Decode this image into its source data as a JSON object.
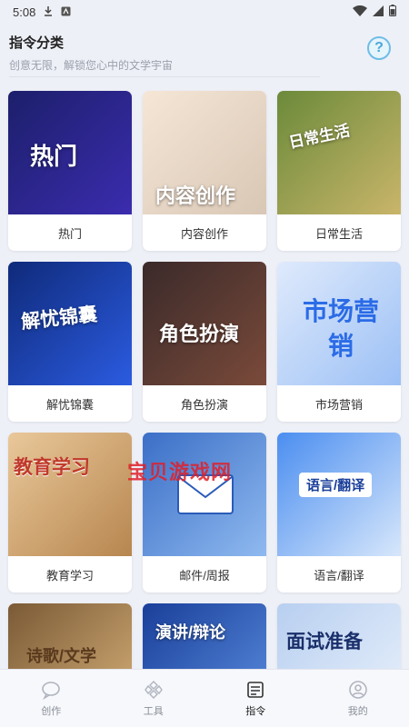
{
  "status": {
    "time": "5:08"
  },
  "header": {
    "title": "指令分类",
    "subtitle": "创意无限，解锁您心中的文学宇宙"
  },
  "cards": [
    {
      "label": "热门",
      "image_text": "热门",
      "colors": [
        "#1c1f6b",
        "#3b2cae"
      ]
    },
    {
      "label": "内容创作",
      "image_text": "内容创作",
      "colors": [
        "#f5e6d6",
        "#d9c7b5"
      ]
    },
    {
      "label": "日常生活",
      "image_text": "日常生活",
      "colors": [
        "#6b8a3a",
        "#c9b56a"
      ]
    },
    {
      "label": "解忧锦囊",
      "image_text": "解忧锦囊",
      "colors": [
        "#0f2a7a",
        "#2b5be0"
      ]
    },
    {
      "label": "角色扮演",
      "image_text": "角色扮演",
      "colors": [
        "#3a2a2a",
        "#7a4a3a"
      ]
    },
    {
      "label": "市场营销",
      "image_text": "市场营销",
      "colors": [
        "#dfeafc",
        "#9cc0f5"
      ]
    },
    {
      "label": "教育学习",
      "image_text": "教育学习",
      "colors": [
        "#e9c89a",
        "#b7864f"
      ]
    },
    {
      "label": "邮件/周报",
      "image_text": "",
      "colors": [
        "#3b6fc7",
        "#8fb9ef"
      ]
    },
    {
      "label": "语言/翻译",
      "image_text": "语言/翻译",
      "colors": [
        "#4b8ef0",
        "#d7e7fb"
      ]
    },
    {
      "label": "",
      "image_text": "诗歌/文学",
      "colors": [
        "#7a5a36",
        "#d9b27a"
      ]
    },
    {
      "label": "",
      "image_text": "演讲/辩论",
      "colors": [
        "#1a3f9a",
        "#5b8fe0"
      ]
    },
    {
      "label": "",
      "image_text": "面试准备",
      "colors": [
        "#b8cff0",
        "#eaf2fc"
      ]
    }
  ],
  "watermark": "宝贝游戏网",
  "nav": [
    {
      "label": "创作",
      "icon": "create-icon",
      "active": false
    },
    {
      "label": "工具",
      "icon": "tools-icon",
      "active": false
    },
    {
      "label": "指令",
      "icon": "commands-icon",
      "active": true
    },
    {
      "label": "我的",
      "icon": "profile-icon",
      "active": false
    }
  ]
}
